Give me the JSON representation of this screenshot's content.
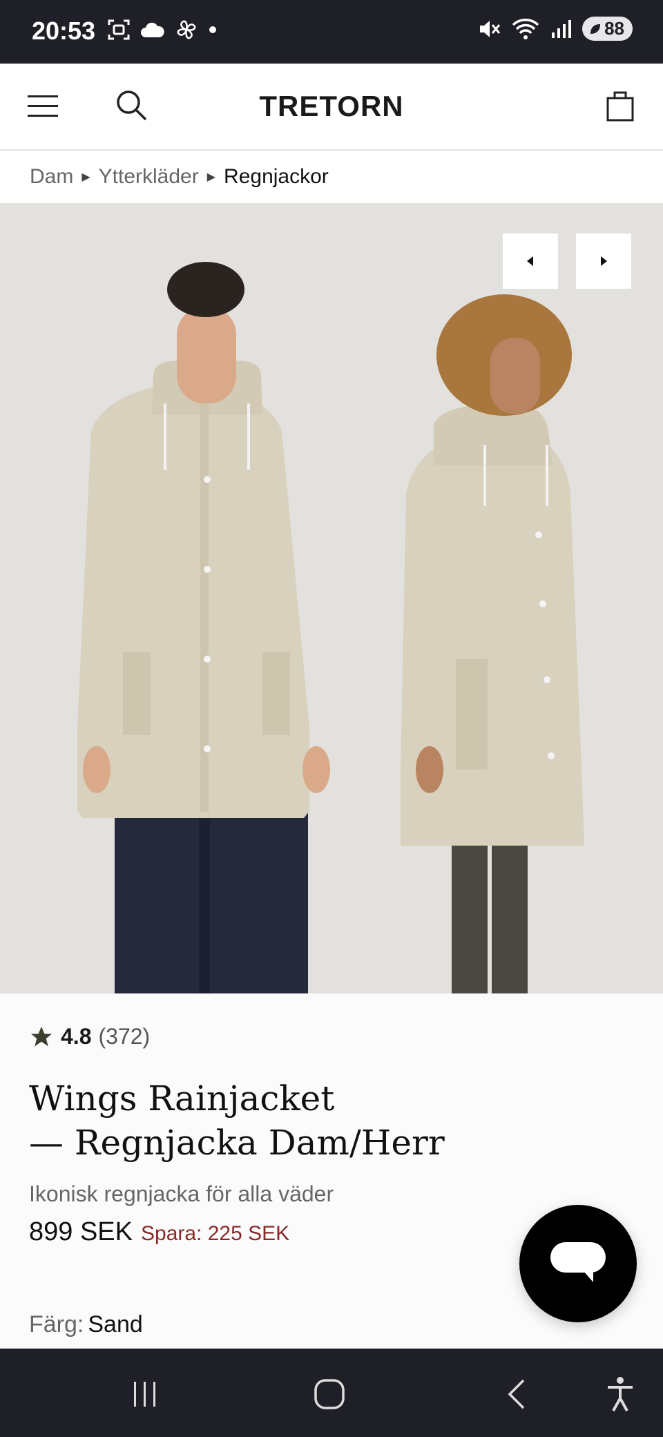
{
  "status_bar": {
    "time": "20:53",
    "left_icons": [
      "screenshot-icon",
      "cloud-icon",
      "pinwheel-icon",
      "dot-icon"
    ],
    "right_icons": [
      "mute-icon",
      "wifi-icon",
      "signal-icon"
    ],
    "battery": "88"
  },
  "header": {
    "logo": "TRETORN",
    "icons": [
      "menu-icon",
      "search-icon",
      "shopping-bag-icon"
    ]
  },
  "breadcrumb": {
    "items": [
      "Dam",
      "Ytterkläder",
      "Regnjackor"
    ]
  },
  "carousel": {
    "prev_icon": "caret-left-icon",
    "next_icon": "caret-right-icon"
  },
  "product": {
    "rating": "4.8",
    "review_count": "(372)",
    "title_line1": "Wings Rainjacket",
    "title_line2": "— Regnjacka Dam/Herr",
    "subtitle": "Ikonisk regnjacka för alla väder",
    "price": "899 SEK",
    "savings": "Spara: 225 SEK",
    "color_label": "Färg:",
    "color_value": "Sand"
  },
  "chat": {
    "icon": "chat-bubble-icon"
  },
  "nav_bar": {
    "icons": [
      "recent-apps-icon",
      "home-icon",
      "back-icon",
      "accessibility-icon"
    ]
  },
  "colors": {
    "jacket": "#d8d1bd",
    "image_bg": "#e3e1de",
    "save_text": "#8a2a2a",
    "system_bar": "#1f2027"
  }
}
